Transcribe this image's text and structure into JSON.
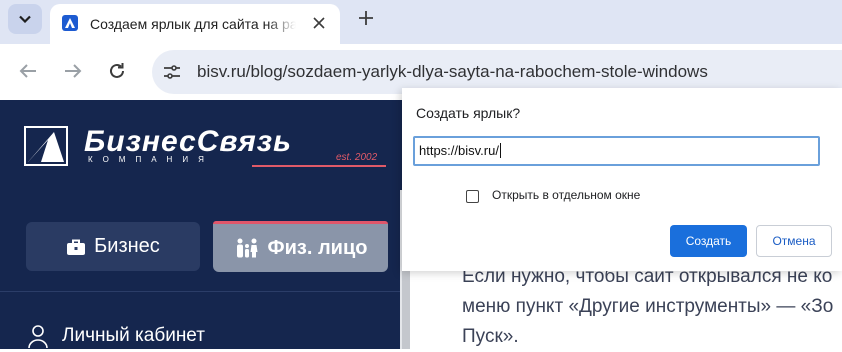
{
  "browser": {
    "tab": {
      "title": "Создаем ярлык для сайта на рабочем столе Windows",
      "favicon": "bisv-logo-favicon"
    },
    "url": "bisv.ru/blog/sozdaem-yarlyk-dlya-sayta-na-rabochem-stole-windows",
    "icons": [
      "chevron-down-icon",
      "close-icon",
      "plus-icon",
      "back-arrow-icon",
      "forward-arrow-icon",
      "reload-icon",
      "site-info-icon"
    ]
  },
  "page": {
    "logo": {
      "name": "БизнесСвязь",
      "sub": "КОМПАНИЯ",
      "est": "est. 2002"
    },
    "nav": {
      "business": "Бизнес",
      "individual": "Физ. лицо",
      "cabinet": "Личный кабинет"
    },
    "article_lines": [
      "Если нужно, чтобы сайт открывался не ко",
      "меню пункт «Другие инструменты» — «Зо",
      "Пуск»."
    ],
    "colors": {
      "sidebar_bg": "#15264e",
      "accent_red": "#e0566a",
      "primary_button": "#1a6fdc"
    }
  },
  "dialog": {
    "title": "Создать ярлык?",
    "input_value": "https://bisv.ru/",
    "checkbox_label": "Открыть в отдельном окне",
    "checkbox_checked": false,
    "create_label": "Создать",
    "cancel_label": "Отмена"
  }
}
